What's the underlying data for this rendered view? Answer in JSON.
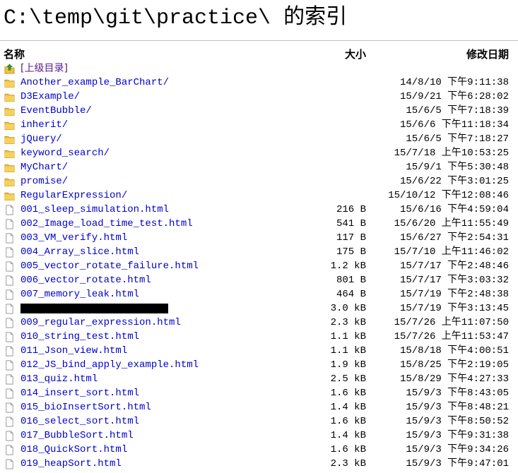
{
  "page": {
    "title": "C:\\temp\\git\\practice\\ 的索引"
  },
  "headers": {
    "name": "名称",
    "size": "大小",
    "modified": "修改日期"
  },
  "colors": {
    "link": "#0000cc",
    "visited": "#551a8b",
    "folder": "#f0c040",
    "up_arrow": "#2f9a2f"
  },
  "entries": [
    {
      "kind": "parent",
      "icon": "up-folder-icon",
      "name": "[上级目录]",
      "size": "",
      "modified": ""
    },
    {
      "kind": "folder",
      "icon": "folder-icon",
      "name": "Another_example_BarChart/",
      "size": "",
      "modified": "14/8/10 下午9:11:38"
    },
    {
      "kind": "folder",
      "icon": "folder-icon",
      "name": "D3Example/",
      "size": "",
      "modified": "15/9/21 下午6:28:02"
    },
    {
      "kind": "folder",
      "icon": "folder-icon",
      "name": "EventBubble/",
      "size": "",
      "modified": "15/6/5 下午7:18:39"
    },
    {
      "kind": "folder",
      "icon": "folder-icon",
      "name": "inherit/",
      "size": "",
      "modified": "15/6/6 下午11:18:34"
    },
    {
      "kind": "folder",
      "icon": "folder-icon",
      "name": "jQuery/",
      "size": "",
      "modified": "15/6/5 下午7:18:27"
    },
    {
      "kind": "folder",
      "icon": "folder-icon",
      "name": "keyword_search/",
      "size": "",
      "modified": "15/7/18 上午10:53:25"
    },
    {
      "kind": "folder",
      "icon": "folder-icon",
      "name": "MyChart/",
      "size": "",
      "modified": "15/9/1 下午5:30:48"
    },
    {
      "kind": "folder",
      "icon": "folder-icon",
      "name": "promise/",
      "size": "",
      "modified": "15/6/22 下午3:01:25"
    },
    {
      "kind": "folder",
      "icon": "folder-icon",
      "name": "RegularExpression/",
      "size": "",
      "modified": "15/10/12 下午12:08:46"
    },
    {
      "kind": "file",
      "icon": "file-icon",
      "name": "001_sleep_simulation.html",
      "size": "216 B",
      "modified": "15/6/16 下午4:59:04"
    },
    {
      "kind": "file",
      "icon": "file-icon",
      "name": "002_Image_load_time_test.html",
      "size": "541 B",
      "modified": "15/6/20 上午11:55:49"
    },
    {
      "kind": "file",
      "icon": "file-icon",
      "name": "003_VM_verify.html",
      "size": "117 B",
      "modified": "15/6/27 下午2:54:31"
    },
    {
      "kind": "file",
      "icon": "file-icon",
      "name": "004_Array_slice.html",
      "size": "175 B",
      "modified": "15/7/10 上午11:46:02"
    },
    {
      "kind": "file",
      "icon": "file-icon",
      "name": "005_vector_rotate_failure.html",
      "size": "1.2 kB",
      "modified": "15/7/17 下午2:48:46"
    },
    {
      "kind": "file",
      "icon": "file-icon",
      "name": "006_vector_rotate.html",
      "size": "801 B",
      "modified": "15/7/17 下午3:03:32"
    },
    {
      "kind": "file",
      "icon": "file-icon",
      "name": "007_memory_leak.html",
      "size": "464 B",
      "modified": "15/7/19 下午2:48:38"
    },
    {
      "kind": "redacted",
      "icon": "file-icon",
      "name": "",
      "size": "3.0 kB",
      "modified": "15/7/19 下午3:13:45"
    },
    {
      "kind": "file",
      "icon": "file-icon",
      "name": "009_regular_expression.html",
      "size": "2.3 kB",
      "modified": "15/7/26 上午11:07:50"
    },
    {
      "kind": "file",
      "icon": "file-icon",
      "name": "010_string_test.html",
      "size": "1.1 kB",
      "modified": "15/7/26 上午11:53:47"
    },
    {
      "kind": "file",
      "icon": "file-icon",
      "name": "011_Json_view.html",
      "size": "1.1 kB",
      "modified": "15/8/18 下午4:00:51"
    },
    {
      "kind": "file",
      "icon": "file-icon",
      "name": "012_JS_bind_apply_example.html",
      "size": "1.9 kB",
      "modified": "15/8/25 下午2:19:05"
    },
    {
      "kind": "file",
      "icon": "file-icon",
      "name": "013_quiz.html",
      "size": "2.5 kB",
      "modified": "15/8/29 下午4:27:33"
    },
    {
      "kind": "file",
      "icon": "file-icon",
      "name": "014_insert_sort.html",
      "size": "1.6 kB",
      "modified": "15/9/3 下午8:43:05"
    },
    {
      "kind": "file",
      "icon": "file-icon",
      "name": "015_bioInsertSort.html",
      "size": "1.4 kB",
      "modified": "15/9/3 下午8:48:21"
    },
    {
      "kind": "file",
      "icon": "file-icon",
      "name": "016_select_sort.html",
      "size": "1.6 kB",
      "modified": "15/9/3 下午8:50:52"
    },
    {
      "kind": "file",
      "icon": "file-icon",
      "name": "017_BubbleSort.html",
      "size": "1.4 kB",
      "modified": "15/9/3 下午9:31:38"
    },
    {
      "kind": "file",
      "icon": "file-icon",
      "name": "018_QuickSort.html",
      "size": "1.6 kB",
      "modified": "15/9/3 下午9:34:26"
    },
    {
      "kind": "file",
      "icon": "file-icon",
      "name": "019_heapSort.html",
      "size": "2.3 kB",
      "modified": "15/9/3 下午9:47:01"
    }
  ]
}
